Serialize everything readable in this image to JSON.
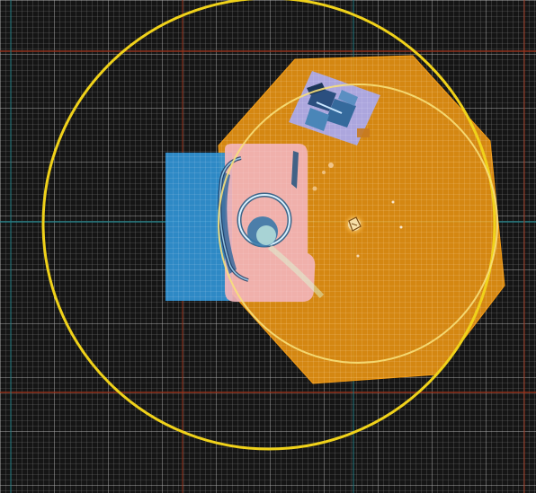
{
  "editor_view": {
    "grid": {
      "minor_color": "#cfcfcf",
      "major_color": "#f2f2f2",
      "axis_red_color": "#a0351c",
      "axis_teal_color": "#1f7f86",
      "background": "#151515"
    },
    "objects": [
      {
        "kind": "octagon-zone",
        "color": "#f39a12"
      },
      {
        "kind": "blue-rectangle",
        "color": "#2f8fcf"
      },
      {
        "kind": "pink-rectangle",
        "color": "#f2b3b9"
      },
      {
        "kind": "tilted-lavender-square",
        "color": "#a8a8ef"
      },
      {
        "kind": "radius-circle",
        "color": "#f0d21a"
      },
      {
        "kind": "inner-circle",
        "color": "#f7e07a"
      },
      {
        "kind": "center-marker-icon",
        "color": "#ffe6a8"
      }
    ]
  }
}
